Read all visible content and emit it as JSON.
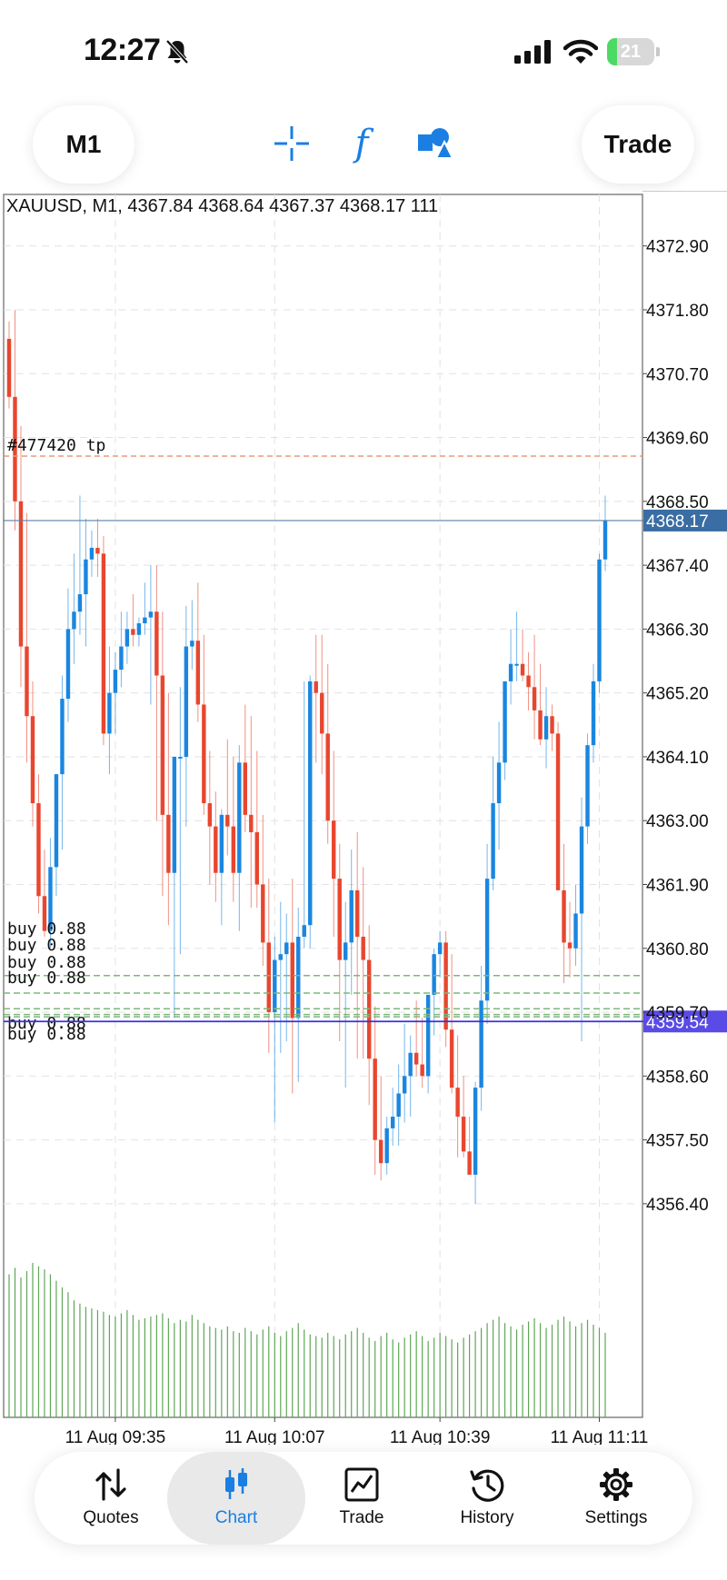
{
  "status_bar": {
    "time": "12:27",
    "battery": 21,
    "battery_label": "21",
    "icons": [
      "bell-slash-icon",
      "signal-icon",
      "wifi-icon",
      "battery-icon"
    ]
  },
  "toolbar": {
    "timeframe": "M1",
    "trade_label": "Trade",
    "icons": [
      "crosshair-icon",
      "indicators-icon",
      "objects-icon"
    ]
  },
  "chart": {
    "header": "XAUUSD, M1, 4367.84 4368.64 4367.37 4368.17 111",
    "price_ticks": [
      "4372.90",
      "4371.80",
      "4370.70",
      "4369.60",
      "4368.50",
      "4367.40",
      "4366.30",
      "4365.20",
      "4364.10",
      "4363.00",
      "4361.90",
      "4360.80",
      "4359.70",
      "4358.60",
      "4357.50",
      "4356.40"
    ],
    "current_price": "4368.17",
    "order_price": "4359.54",
    "tp_label": "#477420 tp",
    "tp_price": 4369.28,
    "time_labels": [
      "11 Aug 09:35",
      "11 Aug 10:07",
      "11 Aug 10:39",
      "11 Aug 11:11"
    ],
    "buy_orders": [
      {
        "label": "buy 0.88",
        "price": 4360.33
      },
      {
        "label": "buy 0.88",
        "price": 4360.03
      },
      {
        "label": "buy 0.88",
        "price": 4359.76
      },
      {
        "label": "buy 0.88",
        "price": 4359.62
      },
      {
        "label": "buy 0.88",
        "price": 4359.66
      }
    ],
    "colors": {
      "bull": "#1a86e0",
      "bear": "#e8462f",
      "volume": "#5fa657",
      "current_line": "#5b7fa6",
      "current_badge": "#3a6da3",
      "order_line": "#3b32d6",
      "order_badge": "#5a4ae6",
      "tp_line": "#e89a7a",
      "buy_line": "#7cb879",
      "grid": "#e2e2e2"
    }
  },
  "chart_data": {
    "type": "candlestick",
    "symbol": "XAUUSD",
    "timeframe": "M1",
    "ylim": [
      4355.6,
      4373.6
    ],
    "open": [
      4371.3,
      4370.3,
      4368.5,
      4366.0,
      4364.8,
      4363.3,
      4361.7,
      4361.1,
      4362.2,
      4363.8,
      4365.1,
      4366.3,
      4366.6,
      4366.9,
      4367.5,
      4367.7,
      4367.6,
      4364.5,
      4365.2,
      4365.6,
      4366.0,
      4366.3,
      4366.2,
      4366.4,
      4366.5,
      4366.6,
      4365.5,
      4363.1,
      4362.1,
      4364.1,
      4364.1,
      4366.0,
      4366.1,
      4365.0,
      4363.3,
      4362.9,
      4362.1,
      4363.1,
      4362.9,
      4362.1,
      4364.0,
      4363.1,
      4362.8,
      4361.9,
      4360.9,
      4359.7,
      4360.6,
      4360.7,
      4360.9,
      4359.6,
      4361.0,
      4361.2,
      4365.4,
      4365.2,
      4364.5,
      4363.0,
      4362.0,
      4360.6,
      4360.9,
      4361.8,
      4361.0,
      4360.6,
      4358.9,
      4357.5,
      4357.1,
      4357.7,
      4357.9,
      4358.3,
      4358.6,
      4359.0,
      4358.8,
      4358.6,
      4360.0,
      4360.7,
      4360.9,
      4359.4,
      4358.4,
      4357.9,
      4357.3,
      4356.9,
      4358.4,
      4359.9,
      4362.0,
      4363.3,
      4364.0,
      4365.4,
      4365.7,
      4365.7,
      4365.5,
      4365.3,
      4364.9,
      4364.4,
      4364.8,
      4364.5,
      4361.8,
      4360.9,
      4360.8,
      4361.4,
      4362.9,
      4364.3,
      4365.4,
      4367.5
    ],
    "high": [
      4371.6,
      4371.8,
      4369.8,
      4368.3,
      4365.4,
      4363.8,
      4362.5,
      4362.7,
      4363.8,
      4365.5,
      4367.0,
      4367.6,
      4368.6,
      4368.2,
      4368.0,
      4368.2,
      4367.9,
      4366.0,
      4365.9,
      4366.6,
      4366.6,
      4366.9,
      4366.5,
      4367.1,
      4367.4,
      4367.4,
      4366.6,
      4365.2,
      4363.7,
      4365.3,
      4366.7,
      4366.8,
      4367.1,
      4366.2,
      4364.2,
      4363.5,
      4363.2,
      4364.4,
      4364.1,
      4364.3,
      4365.0,
      4364.8,
      4364.2,
      4363.1,
      4362.0,
      4361.0,
      4361.6,
      4361.4,
      4362.0,
      4361.5,
      4365.4,
      4365.5,
      4366.2,
      4366.2,
      4365.7,
      4364.2,
      4362.6,
      4361.6,
      4362.5,
      4362.8,
      4362.2,
      4361.2,
      4359.8,
      4358.6,
      4357.9,
      4358.4,
      4358.8,
      4359.5,
      4359.3,
      4359.9,
      4359.6,
      4359.9,
      4360.8,
      4361.1,
      4361.1,
      4360.7,
      4359.3,
      4358.6,
      4357.9,
      4358.5,
      4360.5,
      4362.6,
      4364.1,
      4364.7,
      4365.4,
      4366.3,
      4366.6,
      4366.3,
      4365.9,
      4366.2,
      4365.7,
      4365.3,
      4365.0,
      4364.7,
      4362.6,
      4361.6,
      4361.9,
      4363.4,
      4364.5,
      4365.7,
      4367.6,
      4368.6
    ],
    "low": [
      4370.1,
      4368.0,
      4365.3,
      4364.0,
      4362.9,
      4361.4,
      4361.0,
      4360.8,
      4361.7,
      4362.5,
      4364.7,
      4365.7,
      4366.2,
      4366.0,
      4367.2,
      4367.2,
      4364.3,
      4363.8,
      4364.5,
      4365.3,
      4365.7,
      4366.0,
      4366.0,
      4366.2,
      4365.0,
      4363.0,
      4361.7,
      4361.2,
      4359.6,
      4360.7,
      4362.9,
      4365.6,
      4364.7,
      4363.1,
      4361.9,
      4361.6,
      4361.2,
      4362.4,
      4361.6,
      4361.1,
      4362.8,
      4361.5,
      4361.5,
      4360.5,
      4359.0,
      4357.8,
      4359.0,
      4359.2,
      4358.3,
      4358.5,
      4360.8,
      4360.8,
      4364.0,
      4363.8,
      4362.6,
      4361.0,
      4359.2,
      4358.4,
      4360.0,
      4358.9,
      4358.9,
      4358.1,
      4356.9,
      4356.8,
      4356.9,
      4357.4,
      4357.4,
      4357.8,
      4357.9,
      4358.6,
      4358.4,
      4358.3,
      4359.3,
      4360.3,
      4359.1,
      4358.3,
      4357.2,
      4357.2,
      4356.9,
      4356.4,
      4358.0,
      4359.5,
      4361.8,
      4362.5,
      4363.7,
      4365.0,
      4365.4,
      4365.4,
      4364.9,
      4364.4,
      4364.3,
      4363.9,
      4364.2,
      4361.9,
      4360.2,
      4360.3,
      4360.5,
      4359.2,
      4362.6,
      4364.0,
      4365.2,
      4367.3
    ],
    "close": [
      4370.3,
      4368.5,
      4366.0,
      4364.8,
      4363.3,
      4361.7,
      4361.1,
      4362.2,
      4363.8,
      4365.1,
      4366.3,
      4366.6,
      4366.9,
      4367.5,
      4367.7,
      4367.6,
      4364.5,
      4365.2,
      4365.6,
      4366.0,
      4366.3,
      4366.2,
      4366.4,
      4366.5,
      4366.6,
      4365.5,
      4363.1,
      4362.1,
      4364.1,
      4364.1,
      4366.0,
      4366.1,
      4365.0,
      4363.3,
      4362.9,
      4362.1,
      4363.1,
      4362.9,
      4362.1,
      4364.0,
      4363.1,
      4362.8,
      4361.9,
      4360.9,
      4359.7,
      4360.6,
      4360.7,
      4360.9,
      4359.6,
      4361.0,
      4361.2,
      4365.4,
      4365.2,
      4364.5,
      4363.0,
      4362.0,
      4360.6,
      4360.9,
      4361.8,
      4361.0,
      4360.6,
      4358.9,
      4357.5,
      4357.1,
      4357.7,
      4357.9,
      4358.3,
      4358.6,
      4359.0,
      4358.8,
      4358.6,
      4360.0,
      4360.7,
      4360.9,
      4359.4,
      4358.4,
      4357.9,
      4357.3,
      4356.9,
      4358.4,
      4359.9,
      4362.0,
      4363.3,
      4364.0,
      4365.4,
      4365.7,
      4365.7,
      4365.5,
      4365.3,
      4364.9,
      4364.4,
      4364.8,
      4364.5,
      4361.8,
      4360.9,
      4360.8,
      4361.4,
      4362.9,
      4364.3,
      4365.4,
      4367.5,
      4368.17
    ],
    "volume": [
      88,
      92,
      86,
      90,
      95,
      93,
      91,
      88,
      84,
      80,
      77,
      72,
      70,
      68,
      67,
      66,
      65,
      63,
      62,
      64,
      66,
      63,
      60,
      61,
      62,
      63,
      64,
      61,
      58,
      60,
      59,
      63,
      60,
      58,
      56,
      55,
      54,
      56,
      53,
      52,
      55,
      53,
      51,
      54,
      56,
      52,
      50,
      53,
      55,
      58,
      54,
      51,
      50,
      49,
      52,
      50,
      48,
      51,
      53,
      55,
      52,
      49,
      47,
      50,
      52,
      48,
      46,
      49,
      51,
      53,
      50,
      47,
      49,
      52,
      50,
      48,
      46,
      49,
      51,
      53,
      55,
      58,
      60,
      62,
      58,
      56,
      54,
      57,
      59,
      61,
      58,
      55,
      57,
      60,
      62,
      59,
      56,
      58,
      60,
      57,
      55,
      52
    ]
  },
  "bottom_nav": {
    "items": [
      {
        "id": "quotes",
        "label": "Quotes",
        "icon": "quotes-icon",
        "active": false
      },
      {
        "id": "chart",
        "label": "Chart",
        "icon": "chart-icon",
        "active": true
      },
      {
        "id": "trade",
        "label": "Trade",
        "icon": "trade-icon",
        "active": false
      },
      {
        "id": "history",
        "label": "History",
        "icon": "history-icon",
        "active": false
      },
      {
        "id": "settings",
        "label": "Settings",
        "icon": "settings-icon",
        "active": false
      }
    ]
  }
}
